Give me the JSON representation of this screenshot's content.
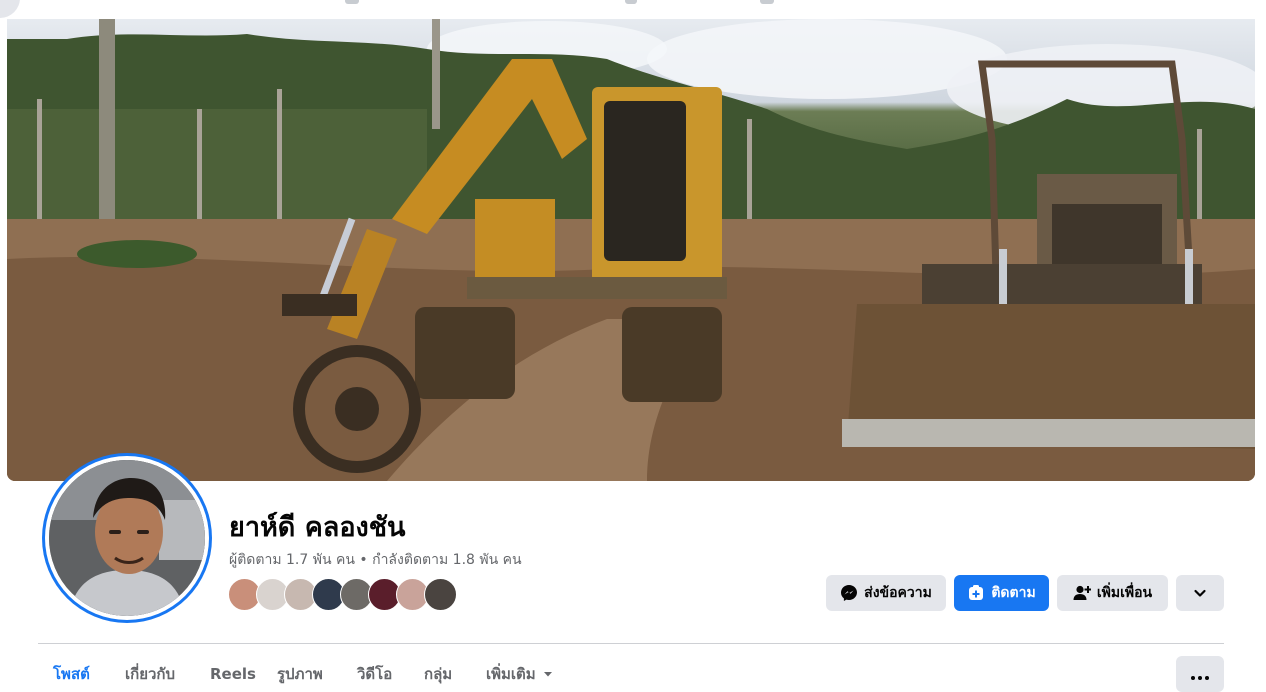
{
  "profile": {
    "name": "ยาห์ดี คลองชัน",
    "followers_text": "ผู้ติดตาม 1.7 พัน คน",
    "separator": "•",
    "following_text": "กำลังติดตาม 1.8 พัน คน"
  },
  "actions": {
    "message_label": "ส่งข้อความ",
    "follow_label": "ติดตาม",
    "add_friend_label": "เพิ่มเพื่อน"
  },
  "tabs": [
    {
      "label": "โพสต์",
      "active": true
    },
    {
      "label": "เกี่ยวกับ",
      "active": false
    },
    {
      "label": "Reels",
      "active": false
    },
    {
      "label": "รูปภาพ",
      "active": false
    },
    {
      "label": "วิดีโอ",
      "active": false
    },
    {
      "label": "กลุ่ม",
      "active": false
    },
    {
      "label": "เพิ่มเติม",
      "active": false
    }
  ],
  "icons": {
    "messenger": "messenger-icon",
    "follow": "follow-icon",
    "add_friend": "add-friend-icon",
    "chevron": "chevron-down-icon",
    "more": "more-dots-icon"
  },
  "colors": {
    "accent": "#1877f2",
    "button_grey": "#e4e6eb",
    "secondary_text": "#65676b"
  }
}
